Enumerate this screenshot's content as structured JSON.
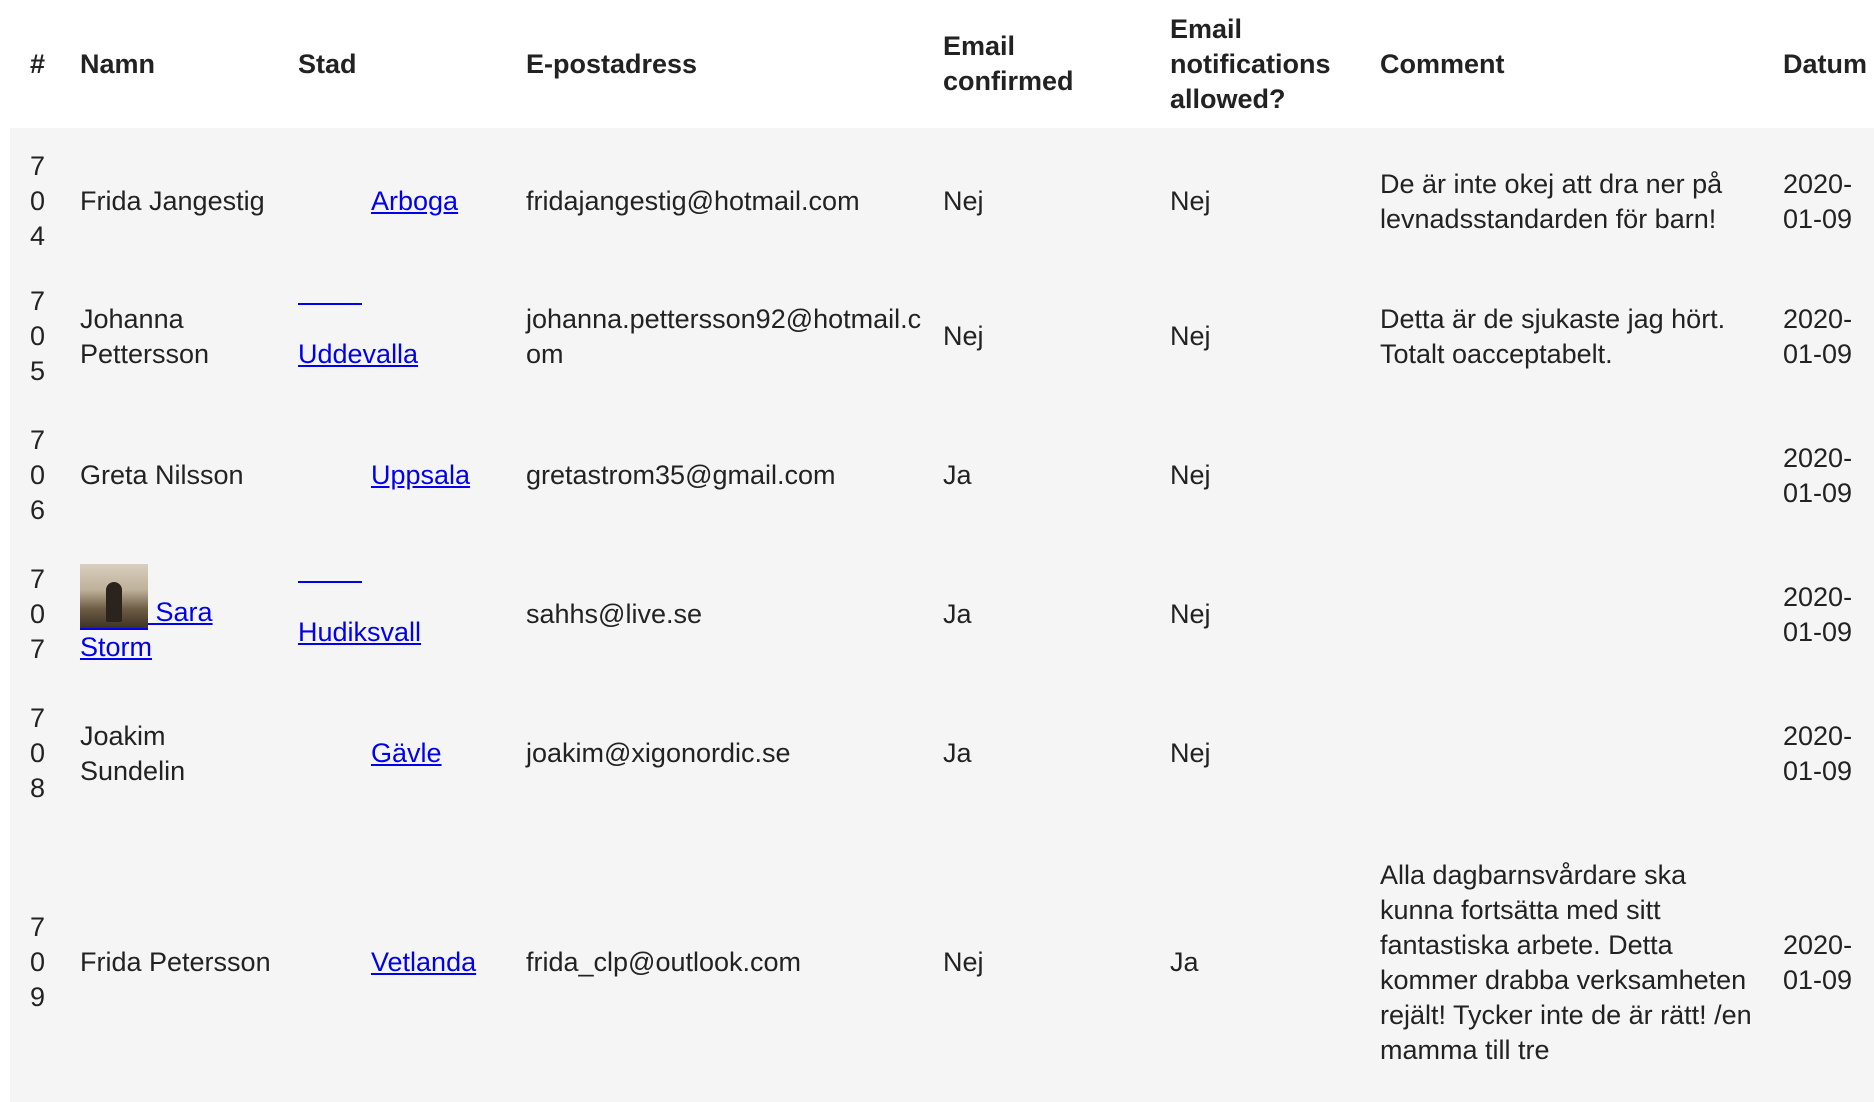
{
  "headers": {
    "num": "#",
    "name": "Namn",
    "city": "Stad",
    "email": "E-postadress",
    "confirmed": "Email confirmed",
    "notifications": "Email notifications allowed?",
    "comment": "Comment",
    "date": "Datum"
  },
  "rows": [
    {
      "num": "704",
      "name": "Frida Jangestig",
      "name_link": false,
      "city": "Arboga",
      "email": "fridajangestig@hotmail.com",
      "confirmed": "Nej",
      "notifications": "Nej",
      "comment": "De är inte okej att dra ner på levnadsstandarden för barn!",
      "date": "2020-01-09"
    },
    {
      "num": "705",
      "name": "Johanna Pettersson",
      "name_link": false,
      "city": "Uddevalla",
      "email": "johanna.pettersson92@hotmail.com",
      "confirmed": "Nej",
      "notifications": "Nej",
      "comment": "Detta är de sjukaste jag hört. Totalt oacceptabelt.",
      "date": "2020-01-09"
    },
    {
      "num": "706",
      "name": "Greta Nilsson",
      "name_link": false,
      "city": "Uppsala",
      "email": "gretastrom35@gmail.com",
      "confirmed": "Ja",
      "notifications": "Nej",
      "comment": "",
      "date": "2020-01-09"
    },
    {
      "num": "707",
      "name": "Sara Storm",
      "name_link": true,
      "city": "Hudiksvall",
      "email": "sahhs@live.se",
      "confirmed": "Ja",
      "notifications": "Nej",
      "comment": "",
      "date": "2020-01-09"
    },
    {
      "num": "708",
      "name": "Joakim Sundelin",
      "name_link": false,
      "city": "Gävle",
      "email": "joakim@xigonordic.se",
      "confirmed": "Ja",
      "notifications": "Nej",
      "comment": "",
      "date": "2020-01-09"
    },
    {
      "num": "709",
      "name": "Frida Petersson",
      "name_link": false,
      "city": "Vetlanda",
      "email": "frida_clp@outlook.com",
      "confirmed": "Nej",
      "notifications": "Ja",
      "comment": "Alla dagbarnsvårdare ska kunna fortsätta med sitt fantastiska arbete. Detta kommer drabba verksamheten rejält! Tycker inte de är rätt! /en mamma till tre",
      "date": "2020-01-09"
    }
  ]
}
